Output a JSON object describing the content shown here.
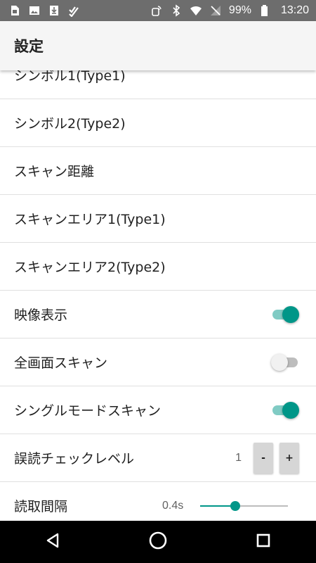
{
  "status_bar": {
    "left_icons": [
      "sim-card-icon",
      "image-icon",
      "download-icon",
      "checklist-icon"
    ],
    "right_icons": [
      "nfc-icon",
      "bluetooth-icon",
      "wifi-icon",
      "no-signal-icon"
    ],
    "battery_percent": "99%",
    "time": "13:20"
  },
  "app_bar": {
    "title": "設定"
  },
  "settings": {
    "items": [
      {
        "label": "シンボル1(Type1)"
      },
      {
        "label": "シンボル2(Type2)"
      },
      {
        "label": "スキャン距離"
      },
      {
        "label": "スキャンエリア1(Type1)"
      },
      {
        "label": "スキャンエリア2(Type2)"
      },
      {
        "label": "映像表示",
        "switch": true
      },
      {
        "label": "全画面スキャン",
        "switch": false
      },
      {
        "label": "シングルモードスキャン",
        "switch": true
      },
      {
        "label": "誤読チェックレベル",
        "value": "1",
        "minus": "-",
        "plus": "+"
      },
      {
        "label": "読取間隔",
        "value": "0.4s",
        "slider_fraction": 0.4
      }
    ]
  },
  "nav_bar": {
    "buttons": [
      "back-icon",
      "home-icon",
      "recents-icon"
    ]
  },
  "colors": {
    "accent": "#009688",
    "accent_light": "#80cbc4",
    "status_bar": "#6d6d6d",
    "app_bar": "#f5f5f5"
  }
}
